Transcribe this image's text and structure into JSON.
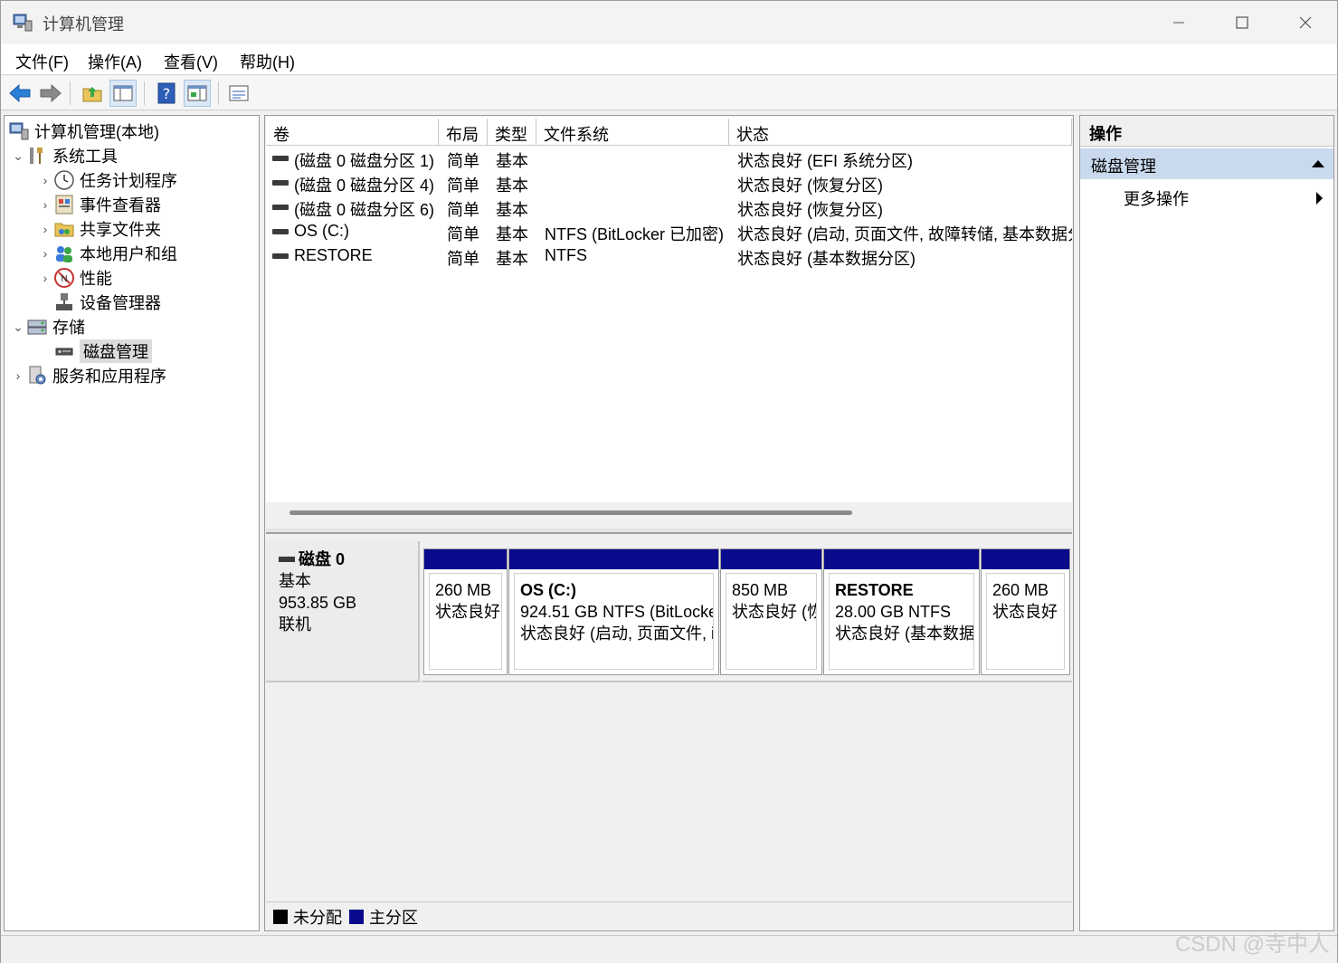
{
  "window": {
    "title": "计算机管理",
    "controls": {
      "minimize": "minimize-icon",
      "maximize": "maximize-icon",
      "close": "close-icon"
    }
  },
  "menu": [
    "文件(F)",
    "操作(A)",
    "查看(V)",
    "帮助(H)"
  ],
  "toolbar": [
    "back-arrow-icon",
    "forward-arrow-icon",
    "up-folder-icon",
    "show-hide-tree-icon",
    "help-icon",
    "show-action-pane-icon",
    "properties-icon"
  ],
  "tree": {
    "root": "计算机管理(本地)",
    "system_tools": "系统工具",
    "task_scheduler": "任务计划程序",
    "event_viewer": "事件查看器",
    "shared_folders": "共享文件夹",
    "local_users": "本地用户和组",
    "performance": "性能",
    "device_manager": "设备管理器",
    "storage": "存储",
    "disk_management": "磁盘管理",
    "services_apps": "服务和应用程序"
  },
  "volume_table": {
    "headers": [
      "卷",
      "布局",
      "类型",
      "文件系统",
      "状态"
    ],
    "rows": [
      {
        "volume": "(磁盘 0 磁盘分区 1)",
        "layout": "简单",
        "type": "基本",
        "fs": "",
        "status": "状态良好 (EFI 系统分区)"
      },
      {
        "volume": "(磁盘 0 磁盘分区 4)",
        "layout": "简单",
        "type": "基本",
        "fs": "",
        "status": "状态良好 (恢复分区)"
      },
      {
        "volume": "(磁盘 0 磁盘分区 6)",
        "layout": "简单",
        "type": "基本",
        "fs": "",
        "status": "状态良好 (恢复分区)"
      },
      {
        "volume": "OS (C:)",
        "layout": "简单",
        "type": "基本",
        "fs": "NTFS (BitLocker 已加密)",
        "status": "状态良好 (启动, 页面文件, 故障转储, 基本数据分"
      },
      {
        "volume": "RESTORE",
        "layout": "简单",
        "type": "基本",
        "fs": "NTFS",
        "status": "状态良好 (基本数据分区)"
      }
    ]
  },
  "disk": {
    "name": "磁盘 0",
    "type": "基本",
    "size": "953.85 GB",
    "state": "联机",
    "partitions": [
      {
        "name": "",
        "size": "260 MB",
        "status": "状态良好"
      },
      {
        "name": "OS  (C:)",
        "size": "924.51 GB NTFS (BitLocke",
        "status": "状态良好 (启动, 页面文件, i"
      },
      {
        "name": "",
        "size": "850 MB",
        "status": "状态良好 (恢"
      },
      {
        "name": "RESTORE",
        "size": "28.00 GB NTFS",
        "status": "状态良好 (基本数据"
      },
      {
        "name": "",
        "size": "260 MB",
        "status": "状态良好"
      }
    ]
  },
  "legend": [
    {
      "label": "未分配",
      "color": "#000000"
    },
    {
      "label": "主分区",
      "color": "#0a0a8c"
    }
  ],
  "actions": {
    "title": "操作",
    "section": "磁盘管理",
    "more": "更多操作"
  },
  "watermark": "CSDN @寺中人"
}
